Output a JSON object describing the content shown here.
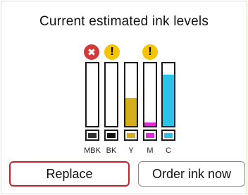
{
  "title": "Current estimated ink levels",
  "ink": [
    {
      "label": "MBK",
      "level": 0.0,
      "color": "#333333",
      "status_icon": "error-icon",
      "status_symbol": "✖"
    },
    {
      "label": "BK",
      "level": 0.0,
      "color": "#111111",
      "status_icon": "warning-icon",
      "status_symbol": "!"
    },
    {
      "label": "Y",
      "level": 0.45,
      "color": "#d6ad1a",
      "status_icon": "",
      "status_symbol": ""
    },
    {
      "label": "M",
      "level": 0.06,
      "color": "#df2ad8",
      "status_icon": "warning-icon",
      "status_symbol": "!"
    },
    {
      "label": "C",
      "level": 0.82,
      "color": "#2fc1e6",
      "status_icon": "",
      "status_symbol": ""
    }
  ],
  "buttons": {
    "replace": "Replace",
    "order": "Order ink now"
  },
  "colors": {
    "error": "#d23a3a",
    "warning": "#f4c400",
    "selected_border": "#c2262b"
  }
}
